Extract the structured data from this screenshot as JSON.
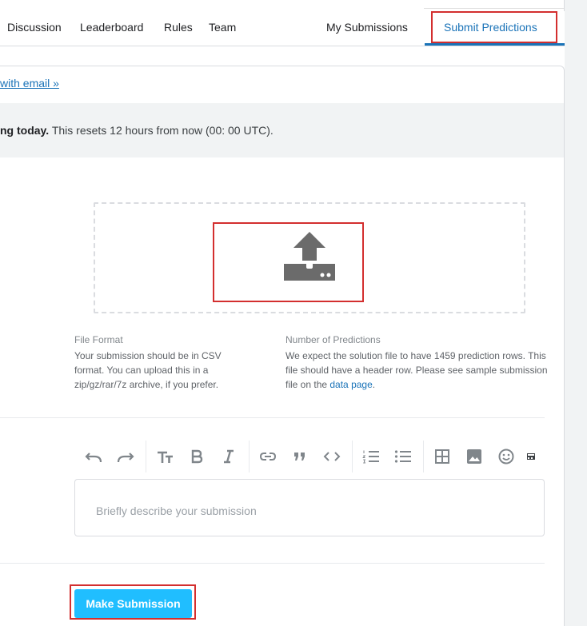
{
  "nav": {
    "tabs": [
      "Discussion",
      "Leaderboard",
      "Rules",
      "Team"
    ],
    "my_submissions": "My Submissions",
    "submit_predictions": "Submit Predictions"
  },
  "verify_link": "with email »",
  "notice": {
    "bold": "ng today.",
    "rest": " This resets 12 hours from now (00: 00 UTC)."
  },
  "upload": {
    "icon": "upload-icon"
  },
  "file_format": {
    "label": "File Format",
    "text": "Your submission should be in CSV format. You can upload this in a zip/gz/rar/7z archive, if you prefer."
  },
  "num_predictions": {
    "label": "Number of Predictions",
    "text_before": "We expect the solution file to have 1459 prediction rows. This file should have a header row. Please see sample submission file on the ",
    "link": "data page",
    "text_after": "."
  },
  "toolbar": [
    "undo-icon",
    "redo-icon",
    "text-size-icon",
    "bold-icon",
    "italic-icon",
    "link-icon",
    "quote-icon",
    "code-icon",
    "ordered-list-icon",
    "bullet-list-icon",
    "table-icon",
    "image-icon",
    "emoji-icon",
    "more-icon"
  ],
  "description": {
    "placeholder": "Briefly describe your submission"
  },
  "submit_button": "Make Submission",
  "colors": {
    "accent": "#1a73b8",
    "button": "#20beff",
    "highlight": "#d32f2f"
  }
}
